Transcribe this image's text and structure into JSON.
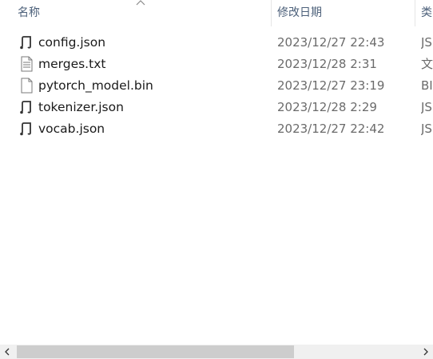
{
  "columns": {
    "name": "名称",
    "date_modified": "修改日期",
    "type": "类"
  },
  "files": [
    {
      "name": "config.json",
      "date": "2023/12/27 22:43",
      "type": "JS",
      "icon": "json-file-icon"
    },
    {
      "name": "merges.txt",
      "date": "2023/12/28 2:31",
      "type": "文",
      "icon": "text-file-icon"
    },
    {
      "name": "pytorch_model.bin",
      "date": "2023/12/27 23:19",
      "type": "BI",
      "icon": "blank-file-icon"
    },
    {
      "name": "tokenizer.json",
      "date": "2023/12/28 2:29",
      "type": "JS",
      "icon": "json-file-icon"
    },
    {
      "name": "vocab.json",
      "date": "2023/12/27 22:42",
      "type": "JS",
      "icon": "json-file-icon"
    }
  ],
  "scrollbar": {
    "position": 0.0,
    "visible_fraction": 0.68
  }
}
